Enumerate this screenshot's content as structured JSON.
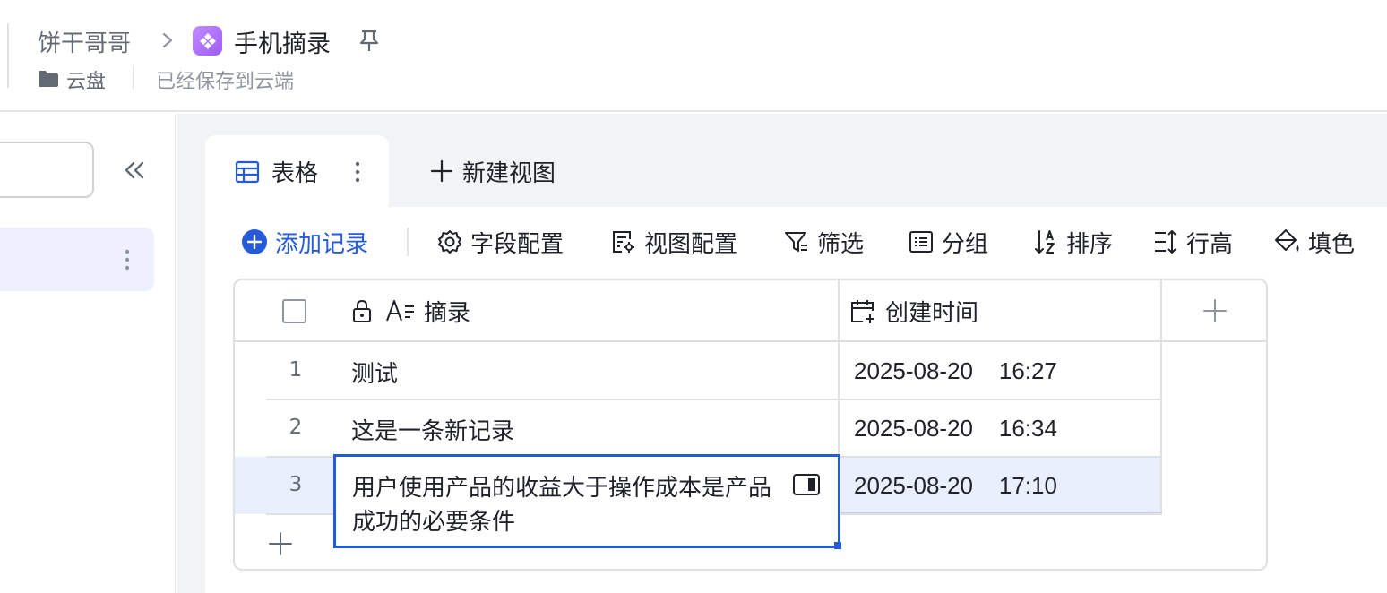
{
  "header": {
    "owner": "饼干哥哥",
    "title": "手机摘录",
    "location": "云盘",
    "save_status": "已经保存到云端"
  },
  "sidebar": {
    "search": {
      "value": "",
      "placeholder": ""
    }
  },
  "tabs": {
    "active_label": "表格",
    "new_view_label": "新建视图"
  },
  "toolbar": {
    "add_record": "添加记录",
    "field_config": "字段配置",
    "view_config": "视图配置",
    "filter": "筛选",
    "group": "分组",
    "sort": "排序",
    "row_height": "行高",
    "fill_color": "填色"
  },
  "table": {
    "columns": [
      "摘录",
      "创建时间"
    ],
    "rows": [
      {
        "num": "1",
        "text": "测试",
        "created": "2025-08-20    16:27"
      },
      {
        "num": "2",
        "text": "这是一条新记录",
        "created": "2025-08-20    16:34"
      },
      {
        "num": "3",
        "text": "用户使用产品的收益大于操作成本是产品成功的必要条件",
        "created": "2025-08-20    17:10"
      }
    ],
    "editing_text": "用户使用产品的收益大于操作成本是产品成功的必要条件"
  },
  "colors": {
    "accent": "#245bdb",
    "selected_row": "#e9effd",
    "sidebar_active": "#eef1fd",
    "app_icon": "#a66cf7"
  }
}
